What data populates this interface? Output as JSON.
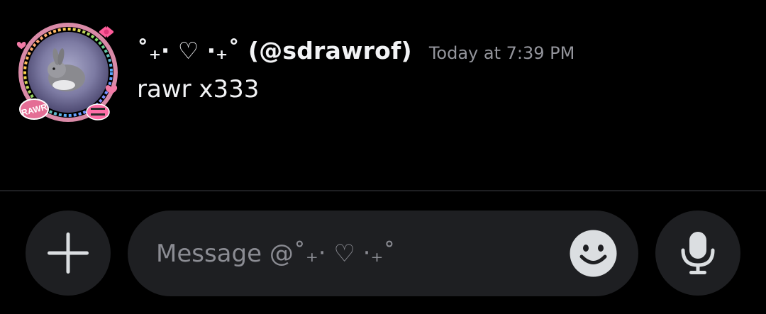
{
  "message": {
    "username": "˚₊‧ ♡ ‧₊˚ (@sdrawrof)",
    "timestamp": "Today at 7:39 PM",
    "text": "rawr x333"
  },
  "avatar": {
    "decoration_text": "RAWR"
  },
  "composer": {
    "placeholder": "Message @˚₊‧ ♡ ‧₊˚",
    "value": ""
  },
  "icons": {
    "attach": "plus-icon",
    "emoji": "smiley-icon",
    "voice": "microphone-icon"
  },
  "colors": {
    "background": "#000000",
    "text_primary": "#f2f3f5",
    "text_muted": "#94959c",
    "button_bg": "#1e1f22",
    "icon_light": "#dbdee1"
  }
}
